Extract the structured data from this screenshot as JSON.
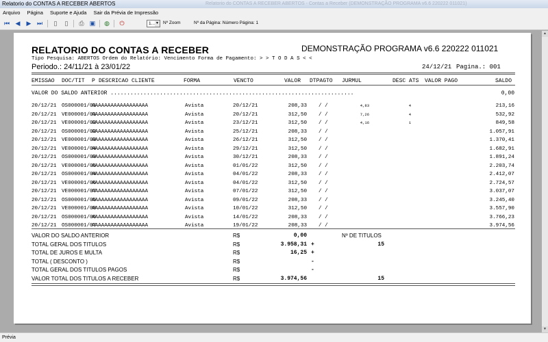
{
  "window": {
    "title": "Relatorio do CONTAS A RECEBER ABERTOS",
    "ghost_title": "Relatorio do CONTAS A RECEBER ABERTOS - Contas a Receber (DEMONSTRAÇÃO PROGRAMA v6.6 220222 011021)"
  },
  "menu": [
    "Arquivo",
    "Página",
    "Suporte e Ajuda",
    "Sair da Prévia de Impressão"
  ],
  "toolbar": {
    "page_value": "1...",
    "zoom_label": "Nº Zoom",
    "page_label": "Nº da Página: Número Página: 1"
  },
  "status": "Prévia",
  "report": {
    "title": "RELATORIO DO CONTAS A RECEBER",
    "demo": "DEMONSTRAÇÃO PROGRAMA v6.6 220222 011021",
    "tipo": "Tipo Pesquisa: ABERTOS   Ordem do Relatório: Vencimento  Forma de Pagamento: > > T O D A S < <",
    "period": "Periodo.: 24/11/21 à 23/01/22",
    "date": "24/12/21",
    "page": "Pagina.: 001",
    "headers": {
      "emissao": "EMISSAO",
      "doc": "DOC/TIT",
      "p": "P",
      "desc": "DESCRICAO CLIENTE",
      "forma": "FORMA",
      "vencto": "VENCTO",
      "valor": "VALOR",
      "dtpagto": "DTPAGTO",
      "jurmul": "JURMUL",
      "desc_ats": "DESC ATS",
      "valor_pago": "VALOR PAGO",
      "saldo": "SALDO"
    },
    "saldo_anterior_label": "VALOR DO SALDO ANTERIOR ..........................................................................",
    "saldo_anterior_value": "0,00",
    "rows": [
      {
        "emissao": "20/12/21",
        "doc": "OS000001/01",
        "desc": "AAAAAAAAAAAAAAAAAA",
        "forma": "Avista",
        "vencto": "20/12/21",
        "valor": "208,33",
        "dtpagto": "/  /",
        "jurmul": "4,83",
        "desc_ats": "4",
        "saldo": "213,16"
      },
      {
        "emissao": "20/12/21",
        "doc": "VE000001/01",
        "desc": "AAAAAAAAAAAAAAAAAA",
        "forma": "Avista",
        "vencto": "20/12/21",
        "valor": "312,50",
        "dtpagto": "/  /",
        "jurmul": "7,26",
        "desc_ats": "4",
        "saldo": "532,92"
      },
      {
        "emissao": "20/12/21",
        "doc": "VE000001/02",
        "desc": "AAAAAAAAAAAAAAAAAA",
        "forma": "Avista",
        "vencto": "23/12/21",
        "valor": "312,50",
        "dtpagto": "/  /",
        "jurmul": "4,16",
        "desc_ats": "1",
        "saldo": "849,58"
      },
      {
        "emissao": "20/12/21",
        "doc": "OS000001/02",
        "desc": "AAAAAAAAAAAAAAAAAA",
        "forma": "Avista",
        "vencto": "25/12/21",
        "valor": "208,33",
        "dtpagto": "/  /",
        "jurmul": "",
        "desc_ats": "",
        "saldo": "1.057,91"
      },
      {
        "emissao": "20/12/21",
        "doc": "VE000001/03",
        "desc": "AAAAAAAAAAAAAAAAAA",
        "forma": "Avista",
        "vencto": "26/12/21",
        "valor": "312,50",
        "dtpagto": "/  /",
        "jurmul": "",
        "desc_ats": "",
        "saldo": "1.370,41"
      },
      {
        "emissao": "20/12/21",
        "doc": "VE000001/04",
        "desc": "AAAAAAAAAAAAAAAAAA",
        "forma": "Avista",
        "vencto": "29/12/21",
        "valor": "312,50",
        "dtpagto": "/  /",
        "jurmul": "",
        "desc_ats": "",
        "saldo": "1.682,91"
      },
      {
        "emissao": "20/12/21",
        "doc": "OS000001/03",
        "desc": "AAAAAAAAAAAAAAAAAA",
        "forma": "Avista",
        "vencto": "30/12/21",
        "valor": "208,33",
        "dtpagto": "/  /",
        "jurmul": "",
        "desc_ats": "",
        "saldo": "1.891,24"
      },
      {
        "emissao": "20/12/21",
        "doc": "VE000001/05",
        "desc": "AAAAAAAAAAAAAAAAAA",
        "forma": "Avista",
        "vencto": "01/01/22",
        "valor": "312,50",
        "dtpagto": "/  /",
        "jurmul": "",
        "desc_ats": "",
        "saldo": "2.203,74"
      },
      {
        "emissao": "20/12/21",
        "doc": "OS000001/04",
        "desc": "AAAAAAAAAAAAAAAAAA",
        "forma": "Avista",
        "vencto": "04/01/22",
        "valor": "208,33",
        "dtpagto": "/  /",
        "jurmul": "",
        "desc_ats": "",
        "saldo": "2.412,07"
      },
      {
        "emissao": "20/12/21",
        "doc": "VE000001/06",
        "desc": "AAAAAAAAAAAAAAAAAA",
        "forma": "Avista",
        "vencto": "04/01/22",
        "valor": "312,50",
        "dtpagto": "/  /",
        "jurmul": "",
        "desc_ats": "",
        "saldo": "2.724,57"
      },
      {
        "emissao": "20/12/21",
        "doc": "VE000001/07",
        "desc": "AAAAAAAAAAAAAAAAAA",
        "forma": "Avista",
        "vencto": "07/01/22",
        "valor": "312,50",
        "dtpagto": "/  /",
        "jurmul": "",
        "desc_ats": "",
        "saldo": "3.037,07"
      },
      {
        "emissao": "20/12/21",
        "doc": "OS000001/05",
        "desc": "AAAAAAAAAAAAAAAAAA",
        "forma": "Avista",
        "vencto": "09/01/22",
        "valor": "208,33",
        "dtpagto": "/  /",
        "jurmul": "",
        "desc_ats": "",
        "saldo": "3.245,40"
      },
      {
        "emissao": "20/12/21",
        "doc": "VE000001/08",
        "desc": "AAAAAAAAAAAAAAAAAA",
        "forma": "Avista",
        "vencto": "10/01/22",
        "valor": "312,50",
        "dtpagto": "/  /",
        "jurmul": "",
        "desc_ats": "",
        "saldo": "3.557,90"
      },
      {
        "emissao": "20/12/21",
        "doc": "OS000001/06",
        "desc": "AAAAAAAAAAAAAAAAAA",
        "forma": "Avista",
        "vencto": "14/01/22",
        "valor": "208,33",
        "dtpagto": "/  /",
        "jurmul": "",
        "desc_ats": "",
        "saldo": "3.766,23"
      },
      {
        "emissao": "20/12/21",
        "doc": "OS000001/07",
        "desc": "AAAAAAAAAAAAAAAAAA",
        "forma": "Avista",
        "vencto": "19/01/22",
        "valor": "208,33",
        "dtpagto": "/  /",
        "jurmul": "",
        "desc_ats": "",
        "saldo": "3.974,56"
      }
    ],
    "totals": [
      {
        "label": "VALOR DO SALDO ANTERIOR",
        "currency": "R$",
        "value": "0,00",
        "sign": "",
        "extra_label": "Nº DE TITULOS",
        "extra_value": ""
      },
      {
        "label": "TOTAL GERAL DOS TITULOS",
        "currency": "R$",
        "value": "3.958,31",
        "sign": "+",
        "extra_label": "",
        "extra_value": "15"
      },
      {
        "label": "TOTAL DE JUROS E MULTA",
        "currency": "R$",
        "value": "16,25",
        "sign": "+",
        "extra_label": "",
        "extra_value": ""
      },
      {
        "label": "TOTAL ( DESCONTO )",
        "currency": "R$",
        "value": "",
        "sign": "-",
        "extra_label": "",
        "extra_value": ""
      },
      {
        "label": "TOTAL GERAL DOS TITULOS PAGOS",
        "currency": "R$",
        "value": "",
        "sign": "-",
        "extra_label": "",
        "extra_value": ""
      },
      {
        "label": "VALOR TOTAL DOS TITULOS A RECEBER",
        "currency": "R$",
        "value": "3.974,56",
        "sign": "",
        "extra_label": "",
        "extra_value": "15"
      }
    ]
  }
}
